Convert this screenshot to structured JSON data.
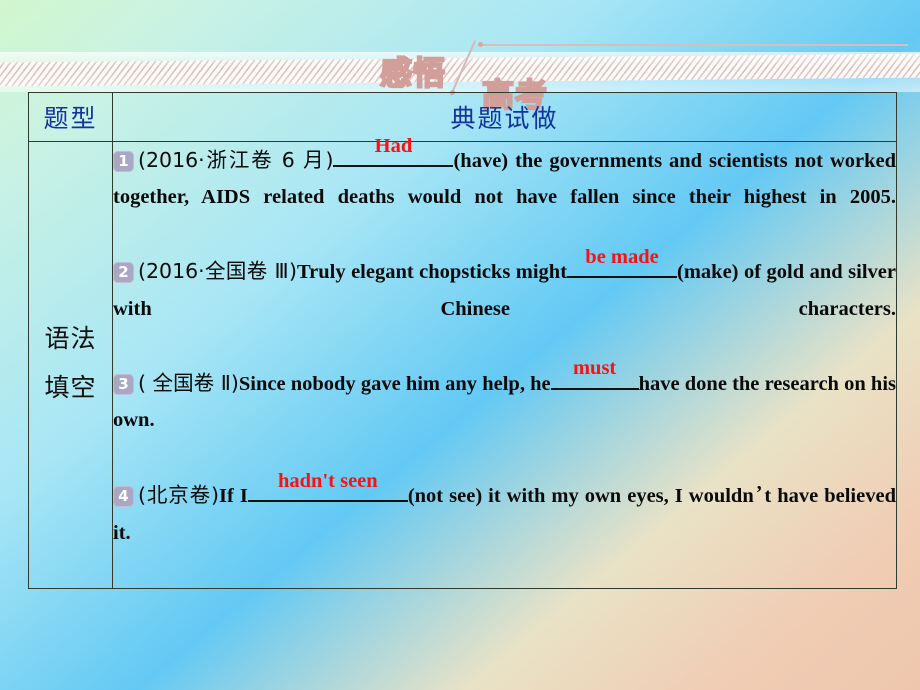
{
  "banner": {
    "word_left": "感悟",
    "word_right": "高考"
  },
  "table": {
    "header": {
      "type_label": "题型",
      "content_label": "典题试做"
    },
    "row": {
      "type_line1": "语法",
      "type_line2": "填空"
    },
    "questions": [
      {
        "number": "1",
        "source": "(2016·浙江卷 6 月)",
        "answer": "Had",
        "text_after": "(have) the governments and scientists not worked together, AIDS related deaths would not have fallen since their highest in 2005."
      },
      {
        "number": "2",
        "source": "(2016·全国卷 Ⅲ)",
        "text_before": "Truly elegant chopsticks might",
        "answer": "be made",
        "text_after": "(make) of gold and silver with Chinese characters."
      },
      {
        "number": "3",
        "source": "( 全国卷 Ⅱ)",
        "text_before": "Since nobody gave him any help, he",
        "answer": "must",
        "text_after": "have done the research on his own."
      },
      {
        "number": "4",
        "source": "(北京卷)",
        "text_before": "If I",
        "answer": "hadn't seen",
        "text_after": "(not see) it with my own eyes, I wouldn",
        "apostrophe": "’",
        "text_tail": "t have believed it."
      }
    ]
  },
  "colors": {
    "answer_red": "#fb1111",
    "header_blue": "#1233a0",
    "badge_fill": "#a9a8c4",
    "banner_rose": "#d29e99"
  }
}
